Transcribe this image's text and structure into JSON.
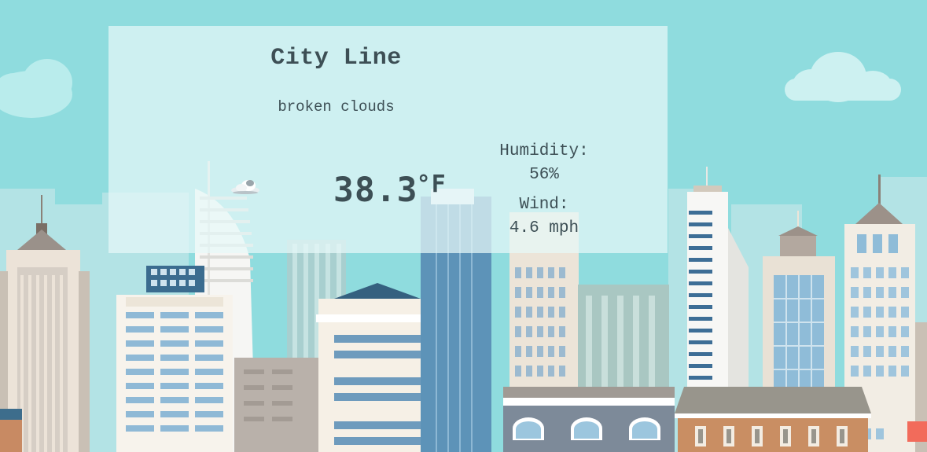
{
  "weather": {
    "city": "City Line",
    "description": "broken clouds",
    "icon": "cloud-icon",
    "temperature": "38.3",
    "unit": "°F",
    "humidity_label": "Humidity:",
    "humidity_value": "56%",
    "wind_label": "Wind:",
    "wind_value": "4.6 mph"
  }
}
